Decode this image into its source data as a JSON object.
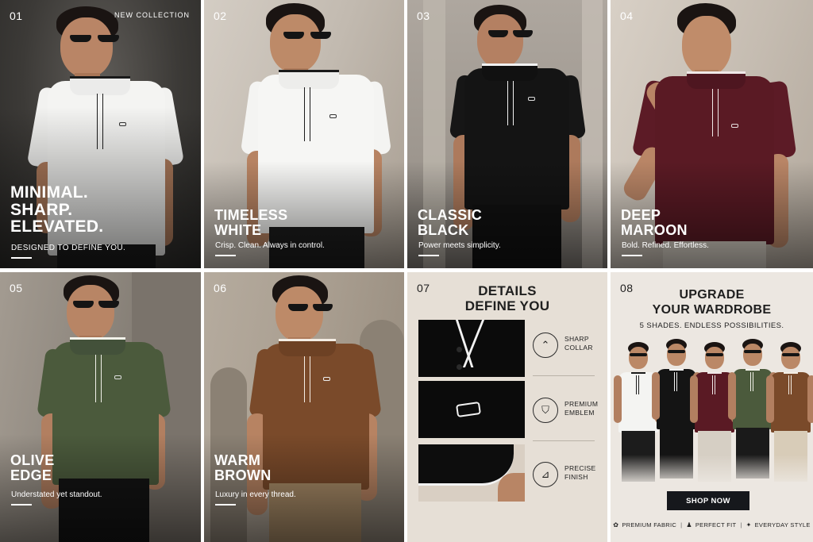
{
  "tiles": [
    {
      "num": "01",
      "tagline": "NEW COLLECTION",
      "headline": [
        "MINIMAL.",
        "SHARP.",
        "ELEVATED."
      ],
      "sub": "DESIGNED TO DEFINE YOU.",
      "shirt_color": "#f4f4f2",
      "trim_color": "#1a1a1a"
    },
    {
      "num": "02",
      "headline": [
        "TIMELESS",
        "WHITE"
      ],
      "sub": "Crisp. Clean. Always in control.",
      "shirt_color": "#f6f6f4",
      "trim_color": "#1a1a1a"
    },
    {
      "num": "03",
      "headline": [
        "CLASSIC",
        "BLACK"
      ],
      "sub": "Power meets simplicity.",
      "shirt_color": "#141414",
      "trim_color": "#f2f2f2"
    },
    {
      "num": "04",
      "headline": [
        "DEEP",
        "MAROON"
      ],
      "sub": "Bold. Refined. Effortless.",
      "shirt_color": "#5a1a24",
      "trim_color": "#f0e8e8"
    },
    {
      "num": "05",
      "headline": [
        "OLIVE",
        "EDGE"
      ],
      "sub": "Understated yet standout.",
      "shirt_color": "#4b5a3c",
      "trim_color": "#f2f2ea"
    },
    {
      "num": "06",
      "headline": [
        "WARM",
        "BROWN"
      ],
      "sub": "Luxury in every thread.",
      "shirt_color": "#7a4a2a",
      "trim_color": "#f4ede4"
    }
  ],
  "details": {
    "num": "07",
    "title": [
      "DETAILS",
      "DEFINE YOU"
    ],
    "items": [
      {
        "icon": "collar-icon",
        "label": [
          "SHARP",
          "COLLAR"
        ]
      },
      {
        "icon": "emblem-icon",
        "label": [
          "PREMIUM",
          "EMBLEM"
        ]
      },
      {
        "icon": "finish-icon",
        "label": [
          "PRECISE",
          "FINISH"
        ]
      }
    ]
  },
  "upgrade": {
    "num": "08",
    "title": [
      "UPGRADE",
      "YOUR WARDROBE"
    ],
    "subtitle": "5 SHADES. ENDLESS POSSIBILITIES.",
    "cta": "SHOP NOW",
    "features": [
      "PREMIUM FABRIC",
      "PERFECT FIT",
      "EVERYDAY STYLE"
    ],
    "shade_colors": [
      "#f4f4f2",
      "#141414",
      "#5a1a24",
      "#4b5a3c",
      "#7a4a2a"
    ]
  },
  "colors": {
    "detail_bg": "#e6dfd6",
    "upgrade_bg": "#ece7e1",
    "white_tile_bg": "#bcb5ac",
    "black_tile_bg": "#8f8a84",
    "maroon_tile_bg": "#c8bfb5",
    "olive_tile_bg": "#8c857c",
    "brown_tile_bg": "#a69a8c"
  }
}
